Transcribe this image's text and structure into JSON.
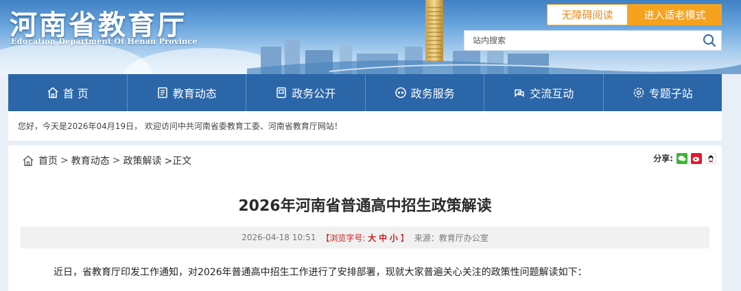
{
  "header": {
    "site_title": "河南省教育厅",
    "site_subtitle": "Education Department Of Henan Province",
    "accessibility_label": "无障碍阅读",
    "elder_mode_label": "进入适老模式",
    "search_placeholder": "站内搜索"
  },
  "nav": {
    "items": [
      {
        "label": "首 页",
        "icon": "home-icon"
      },
      {
        "label": "教育动态",
        "icon": "document-icon"
      },
      {
        "label": "政务公开",
        "icon": "notebook-icon"
      },
      {
        "label": "政务服务",
        "icon": "service-icon"
      },
      {
        "label": "交流互动",
        "icon": "interaction-icon"
      },
      {
        "label": "专题子站",
        "icon": "settings-icon"
      }
    ]
  },
  "welcome": {
    "text": "您好，今天是2026年04月19日， 欢迎访问中共河南省委教育工委、河南省教育厅网站！"
  },
  "breadcrumb": {
    "home": "首页",
    "level1": "教育动态",
    "level2": "政策解读",
    "current": ">正文",
    "sep1": ">",
    "sep2": ">"
  },
  "share": {
    "label": "分享:"
  },
  "article": {
    "title": "2026年河南省普通高中招生政策解读",
    "date": "2026-04-18 10:51",
    "font_size_label": "【浏览字号:",
    "font_large": "大",
    "font_medium": "中",
    "font_small": "小",
    "font_size_end": "】",
    "source": "来源：教育厅办公室",
    "first_paragraph": "近日，省教育厅印发工作通知，对2026年普通高中招生工作进行了安排部署，现就大家普遍关心关注的政策性问题解读如下："
  },
  "colors": {
    "nav_bg": "#2b66a8",
    "accent_orange": "#f5a21e",
    "meta_red": "#cc1c1c"
  }
}
